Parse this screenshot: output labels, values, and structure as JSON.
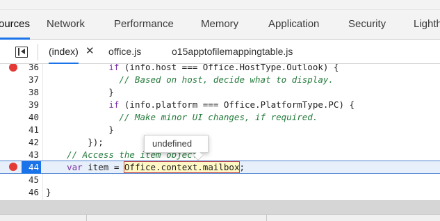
{
  "main_tabs": [
    "ources",
    "Network",
    "Performance",
    "Memory",
    "Application",
    "Security",
    "Lighth"
  ],
  "file_tabs": [
    "(index)",
    "office.js",
    "o15apptofilemappingtable.js"
  ],
  "close_glyph": "✕",
  "tooltip": "undefined",
  "code": {
    "l36": {
      "n": "36",
      "pre": "            ",
      "kw": "if",
      "rest": " (info.host === Office.HostType.Outlook) {"
    },
    "l37": {
      "n": "37",
      "pre": "              ",
      "cm": "// Based on host, decide what to display."
    },
    "l38": {
      "n": "38",
      "text": "            }"
    },
    "l39": {
      "n": "39",
      "pre": "            ",
      "kw": "if",
      "rest": " (info.platform === Office.PlatformType.PC) {"
    },
    "l40": {
      "n": "40",
      "pre": "              ",
      "cm": "// Make minor UI changes, if required."
    },
    "l41": {
      "n": "41",
      "text": "            }"
    },
    "l42": {
      "n": "42",
      "text": "        });"
    },
    "l43": {
      "n": "43",
      "pre": "    ",
      "cm": "// Access the item object."
    },
    "l44": {
      "n": "44",
      "pre": "    ",
      "kw": "var",
      "mid": " item = ",
      "hl": "Office.context.mailbox",
      "end": ";"
    },
    "l45": {
      "n": "45",
      "text": ""
    },
    "l46": {
      "n": "46",
      "text": "}"
    }
  }
}
